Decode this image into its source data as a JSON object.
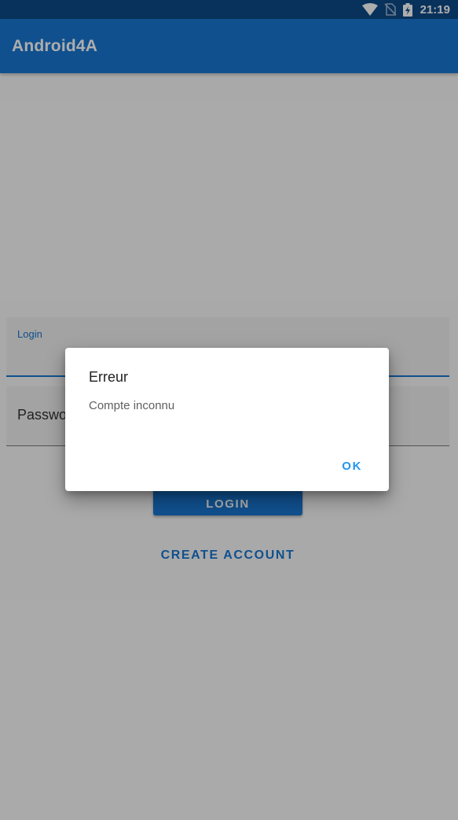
{
  "status_bar": {
    "time": "21:19",
    "icons": [
      "wifi-icon",
      "no-sim-icon",
      "battery-charging-icon"
    ]
  },
  "app_bar": {
    "title": "Android4A"
  },
  "form": {
    "login_label": "Login",
    "password_placeholder": "Password",
    "login_button": "LOGIN",
    "create_account_button": "CREATE ACCOUNT"
  },
  "dialog": {
    "title": "Erreur",
    "message": "Compte inconnu",
    "ok_button": "OK"
  },
  "colors": {
    "primary": "#1976d2",
    "primary_dark": "#0d4a86",
    "dialog_accent": "#2196f3"
  }
}
